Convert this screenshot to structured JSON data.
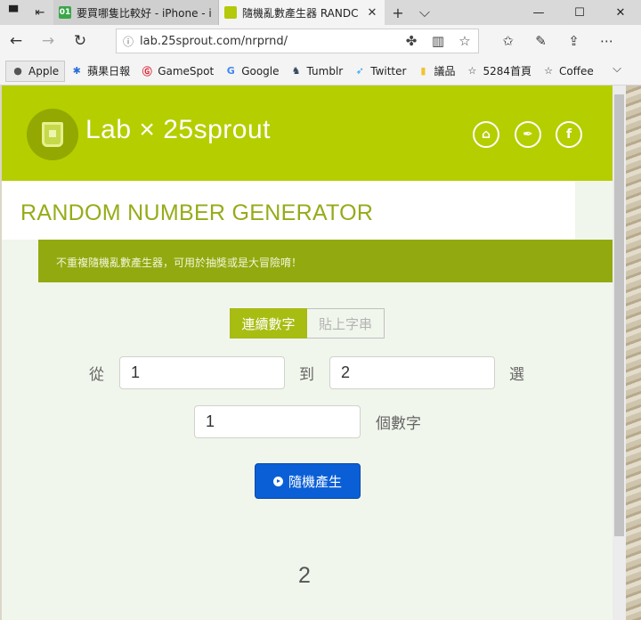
{
  "browser": {
    "tabs": [
      {
        "title": "要買哪隻比較好 - iPhone - i"
      },
      {
        "title": "隨機亂數產生器 RANDC",
        "close": "✕"
      }
    ],
    "new_tab": "+",
    "tab_menu": "⌵",
    "window": {
      "minimize": "—",
      "maximize": "☐",
      "close": "✕"
    },
    "url": "lab.25sprout.com/nrprnd/",
    "favorites": [
      {
        "label": "Apple",
        "icon": "apple-icon"
      },
      {
        "label": "蘋果日報",
        "icon": "apple-daily-icon"
      },
      {
        "label": "GameSpot",
        "icon": "gamespot-icon"
      },
      {
        "label": "Google",
        "icon": "google-icon"
      },
      {
        "label": "Tumblr",
        "icon": "tumblr-icon"
      },
      {
        "label": "Twitter",
        "icon": "twitter-icon"
      },
      {
        "label": "議品",
        "icon": "folder-icon"
      },
      {
        "label": "5284首頁",
        "icon": "star-icon"
      },
      {
        "label": "Coffee",
        "icon": "star-icon"
      }
    ]
  },
  "site": {
    "logo_text": "Lab × 25sprout",
    "title": "RANDOM NUMBER GENERATOR",
    "description": "不重複隨機亂數產生器，可用於抽獎或是大冒險唷！",
    "social": [
      "home-icon",
      "quill-icon",
      "facebook-icon"
    ]
  },
  "form": {
    "tabs": [
      {
        "label": "連續數字",
        "active": true
      },
      {
        "label": "貼上字串",
        "active": false
      }
    ],
    "from_label": "從",
    "from_value": "1",
    "to_label": "到",
    "to_value": "2",
    "pick_label": "選",
    "count_value": "1",
    "count_label": "個數字",
    "generate_label": "隨機產生"
  },
  "result": "2",
  "colors": {
    "header_green": "#b5ce00",
    "desc_green": "#93a910",
    "title_green": "#97ab19",
    "button_blue": "#0a5fd6",
    "page_bg": "#f1f6ec"
  }
}
